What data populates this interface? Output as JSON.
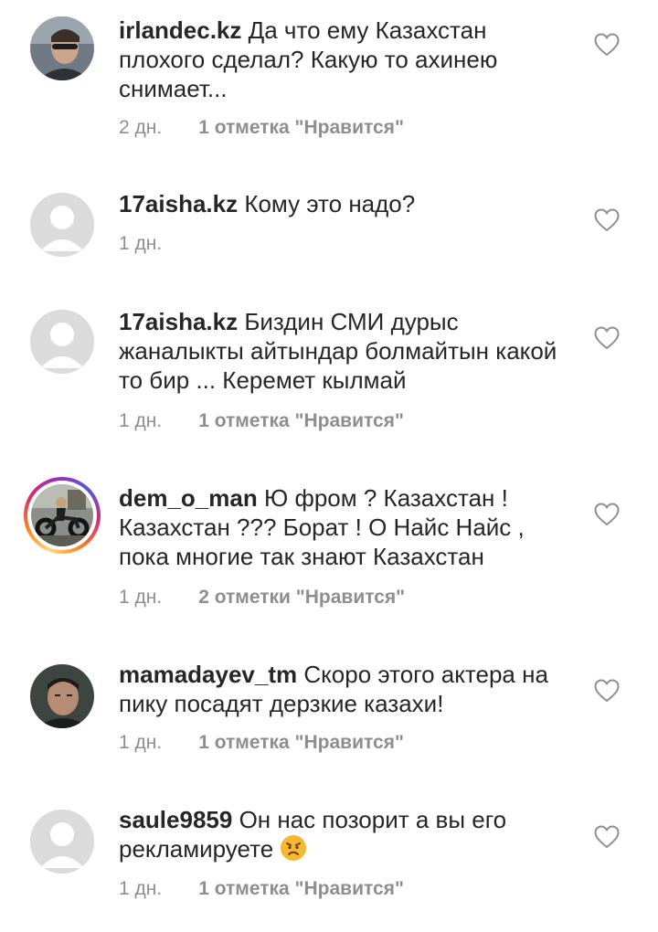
{
  "comments": [
    {
      "username": "irlandec.kz",
      "text": "Да что ему Казахстан плохого сделал? Какую то ахинею снимает...",
      "time": "2 дн.",
      "likes": "1 отметка \"Нравится\"",
      "avatar": "photo"
    },
    {
      "username": "17aisha.kz",
      "text": "Кому это надо?",
      "time": "1 дн.",
      "likes": "",
      "avatar": "placeholder"
    },
    {
      "username": "17aisha.kz",
      "text": "Биздин СМИ дурыс жаналыкты айтындар болмайтын какой то бир ... Керемет кылмай",
      "time": "1 дн.",
      "likes": "1 отметка \"Нравится\"",
      "avatar": "placeholder"
    },
    {
      "username": "dem_o_man",
      "text": "Ю фром ? Казахстан ! Казахстан ??? Борат ! О Найс Найс , пока многие так знают Казахстан",
      "time": "1 дн.",
      "likes": "2 отметки \"Нравится\"",
      "avatar": "story-ring"
    },
    {
      "username": "mamadayev_tm",
      "text": "Скоро этого актера на пику посадят дерзкие казахи!",
      "time": "1 дн.",
      "likes": "1 отметка \"Нравится\"",
      "avatar": "photo"
    },
    {
      "username": "saule9859",
      "text": "Он нас позорит а вы его рекламируете",
      "emoji": "persevering-face",
      "time": "1 дн.",
      "likes": "1 отметка \"Нравится\"",
      "avatar": "placeholder"
    }
  ],
  "colors": {
    "text": "#262626",
    "secondary": "#8e8e8e",
    "placeholder_avatar": "#dbdbdb"
  }
}
